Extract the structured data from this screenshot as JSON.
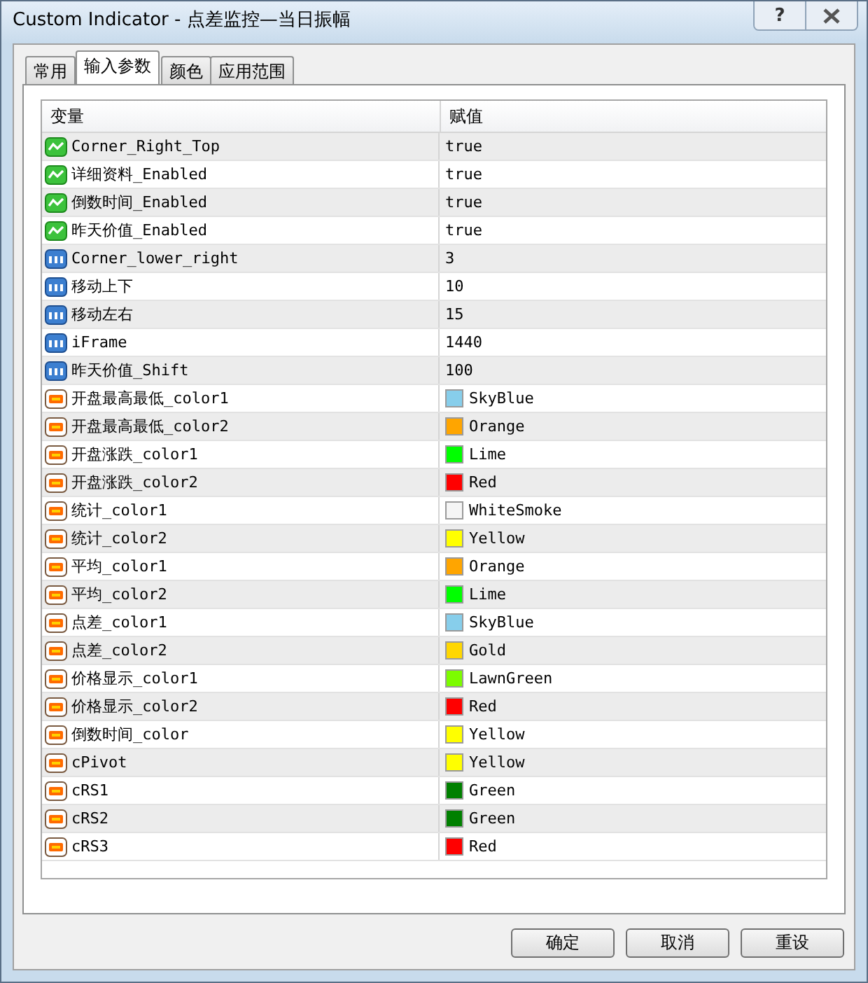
{
  "window": {
    "title": "Custom Indicator - 点差监控—当日振幅",
    "help": "?"
  },
  "tabs": [
    {
      "label": "常用",
      "selected": false
    },
    {
      "label": "输入参数",
      "selected": true
    },
    {
      "label": "颜色",
      "selected": false
    },
    {
      "label": "应用范围",
      "selected": false
    }
  ],
  "table": {
    "columns": [
      "变量",
      "赋值"
    ],
    "rows": [
      {
        "kind": "bool",
        "name": "Corner_Right_Top",
        "value": "true"
      },
      {
        "kind": "bool",
        "name": "详细资料_Enabled",
        "value": "true"
      },
      {
        "kind": "bool",
        "name": "倒数时间_Enabled",
        "value": "true"
      },
      {
        "kind": "bool",
        "name": "昨天价值_Enabled",
        "value": "true"
      },
      {
        "kind": "int",
        "name": "Corner_lower_right",
        "value": "3"
      },
      {
        "kind": "int",
        "name": "移动上下",
        "value": "10"
      },
      {
        "kind": "int",
        "name": "移动左右",
        "value": "15"
      },
      {
        "kind": "int",
        "name": "iFrame",
        "value": "1440"
      },
      {
        "kind": "int",
        "name": "昨天价值_Shift",
        "value": "100"
      },
      {
        "kind": "color",
        "name": "开盘最高最低_color1",
        "value": "SkyBlue",
        "color": "#87ceeb"
      },
      {
        "kind": "color",
        "name": "开盘最高最低_color2",
        "value": "Orange",
        "color": "#ffa500"
      },
      {
        "kind": "color",
        "name": "开盘涨跌_color1",
        "value": "Lime",
        "color": "#00ff00"
      },
      {
        "kind": "color",
        "name": "开盘涨跌_color2",
        "value": "Red",
        "color": "#ff0000"
      },
      {
        "kind": "color",
        "name": "统计_color1",
        "value": "WhiteSmoke",
        "color": "#f5f5f5"
      },
      {
        "kind": "color",
        "name": "统计_color2",
        "value": "Yellow",
        "color": "#ffff00"
      },
      {
        "kind": "color",
        "name": "平均_color1",
        "value": "Orange",
        "color": "#ffa500"
      },
      {
        "kind": "color",
        "name": "平均_color2",
        "value": "Lime",
        "color": "#00ff00"
      },
      {
        "kind": "color",
        "name": "点差_color1",
        "value": "SkyBlue",
        "color": "#87ceeb"
      },
      {
        "kind": "color",
        "name": "点差_color2",
        "value": "Gold",
        "color": "#ffd700"
      },
      {
        "kind": "color",
        "name": "价格显示_color1",
        "value": "LawnGreen",
        "color": "#7cfc00"
      },
      {
        "kind": "color",
        "name": "价格显示_color2",
        "value": "Red",
        "color": "#ff0000"
      },
      {
        "kind": "color",
        "name": "倒数时间_color",
        "value": "Yellow",
        "color": "#ffff00"
      },
      {
        "kind": "color",
        "name": "cPivot",
        "value": "Yellow",
        "color": "#ffff00"
      },
      {
        "kind": "color",
        "name": "cRS1",
        "value": "Green",
        "color": "#008000"
      },
      {
        "kind": "color",
        "name": "cRS2",
        "value": "Green",
        "color": "#008000"
      },
      {
        "kind": "color",
        "name": "cRS3",
        "value": "Red",
        "color": "#ff0000"
      }
    ]
  },
  "buttons": [
    "确定",
    "取消",
    "重设"
  ]
}
